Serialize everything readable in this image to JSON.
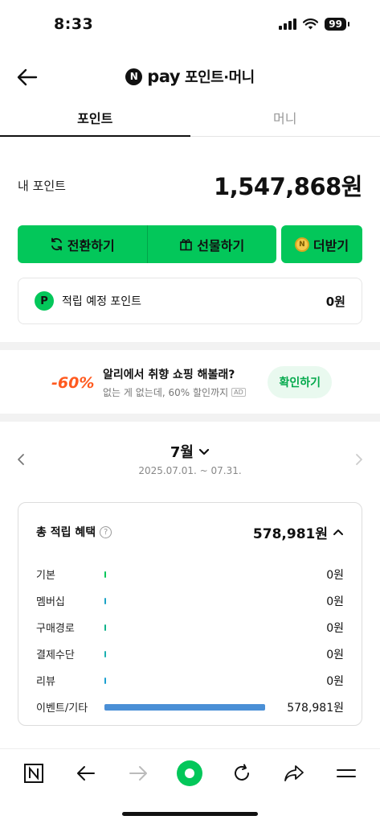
{
  "status_bar": {
    "time": "8:33",
    "battery": "99"
  },
  "header": {
    "brand_letter": "N",
    "brand_word": "pay",
    "title": "포인트·머니"
  },
  "tabs": [
    {
      "label": "포인트",
      "active": true
    },
    {
      "label": "머니",
      "active": false
    }
  ],
  "points": {
    "label": "내 포인트",
    "value": "1,547,868원"
  },
  "actions": {
    "convert": "전환하기",
    "gift": "선물하기",
    "more": "더받기",
    "coin_letter": "N"
  },
  "pending": {
    "badge": "P",
    "label": "적립 예정 포인트",
    "value": "0원"
  },
  "ad": {
    "logo_text": "-60%",
    "title": "알리에서 취향 쇼핑 해볼래?",
    "subtitle": "없는 게 없는데, 60% 할인까지",
    "badge": "AD",
    "button": "확인하기"
  },
  "month": {
    "label": "7월",
    "range": "2025.07.01. ~ 07.31."
  },
  "summary": {
    "title": "총 적립 혜택",
    "help": "?",
    "total": "578,981원",
    "rows": [
      {
        "label": "기본",
        "value": "0원",
        "share": 0,
        "color": "#03c75a"
      },
      {
        "label": "멤버십",
        "value": "0원",
        "share": 0,
        "color": "#1ba3c6"
      },
      {
        "label": "구매경로",
        "value": "0원",
        "share": 0,
        "color": "#0fb38a"
      },
      {
        "label": "결제수단",
        "value": "0원",
        "share": 0,
        "color": "#1bb0b0"
      },
      {
        "label": "리뷰",
        "value": "0원",
        "share": 0,
        "color": "#1aa0d0"
      },
      {
        "label": "이벤트/기타",
        "value": "578,981원",
        "share": 1,
        "color": "#4a8fd6"
      }
    ]
  },
  "bottom_nav": [
    {
      "icon": "naver-home-icon"
    },
    {
      "icon": "back-arrow-icon"
    },
    {
      "icon": "forward-arrow-icon"
    },
    {
      "icon": "green-dot-icon"
    },
    {
      "icon": "refresh-icon"
    },
    {
      "icon": "share-icon"
    },
    {
      "icon": "menu-icon"
    }
  ]
}
